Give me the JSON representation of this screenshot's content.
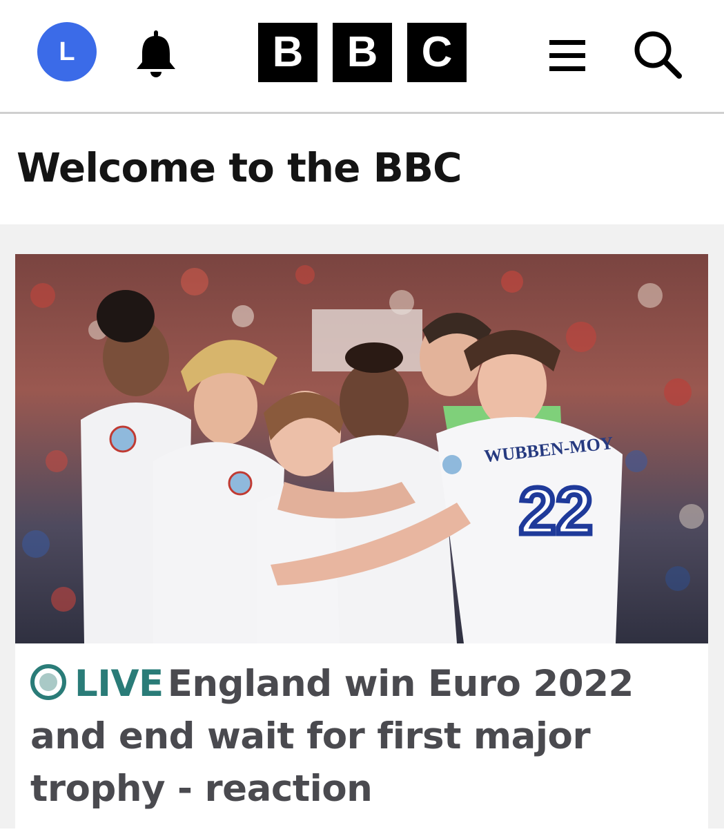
{
  "header": {
    "avatar_initial": "L",
    "bell_icon": "notification-bell-icon",
    "logo_letters": [
      "B",
      "B",
      "C"
    ],
    "menu_icon": "hamburger-menu-icon",
    "search_icon": "search-icon",
    "avatar_color": "#3b6be8"
  },
  "welcome": {
    "title": "Welcome to the BBC"
  },
  "story": {
    "image_alt": "England players celebrating",
    "jersey_name": "WUBBEN-MOY",
    "jersey_number": "22",
    "live_label": "LIVE",
    "headline": "England win Euro 2022 and end wait for first major trophy - reaction",
    "live_color": "#2a7c78",
    "headline_color": "#4a4a4f"
  }
}
